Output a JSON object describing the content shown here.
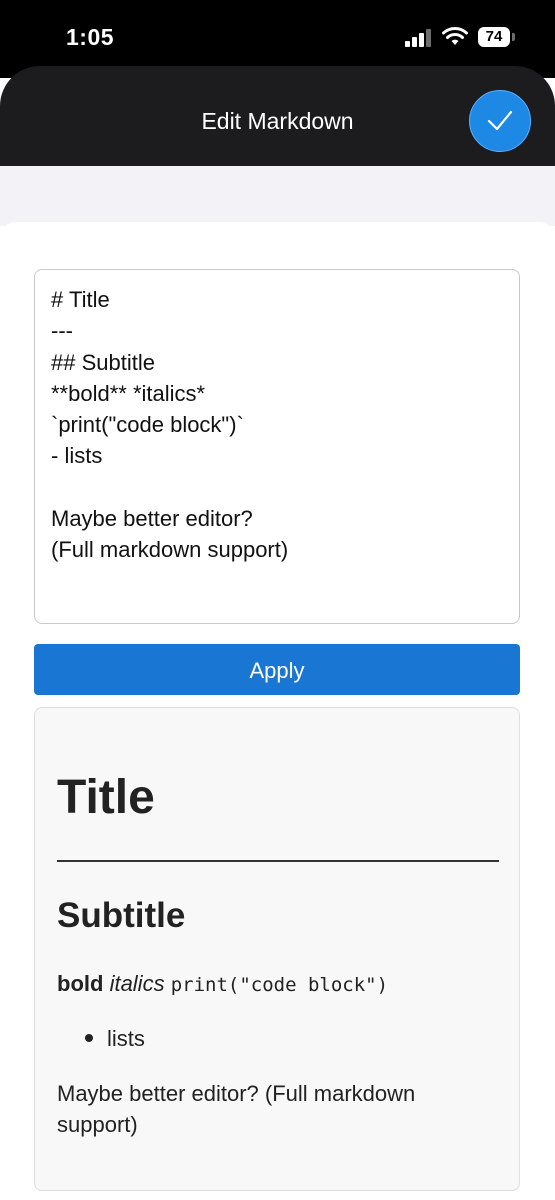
{
  "status_bar": {
    "time": "1:05",
    "battery": "74"
  },
  "nav": {
    "title": "Edit Markdown"
  },
  "editor": {
    "value": "# Title\n---\n## Subtitle\n**bold** *italics*\n`print(\"code block\")`\n- lists\n\nMaybe better editor?\n(Full markdown support)"
  },
  "apply_label": "Apply",
  "preview": {
    "title": "Title",
    "subtitle": "Subtitle",
    "bold": "bold",
    "italics": "italics",
    "code": "print(\"code block\")",
    "list_items": [
      "lists"
    ],
    "paragraph": "Maybe better editor? (Full markdown support)"
  },
  "colors": {
    "accent": "#1976d2",
    "nav_bg": "#1c1c1e",
    "confirm": "#1e88e5"
  }
}
